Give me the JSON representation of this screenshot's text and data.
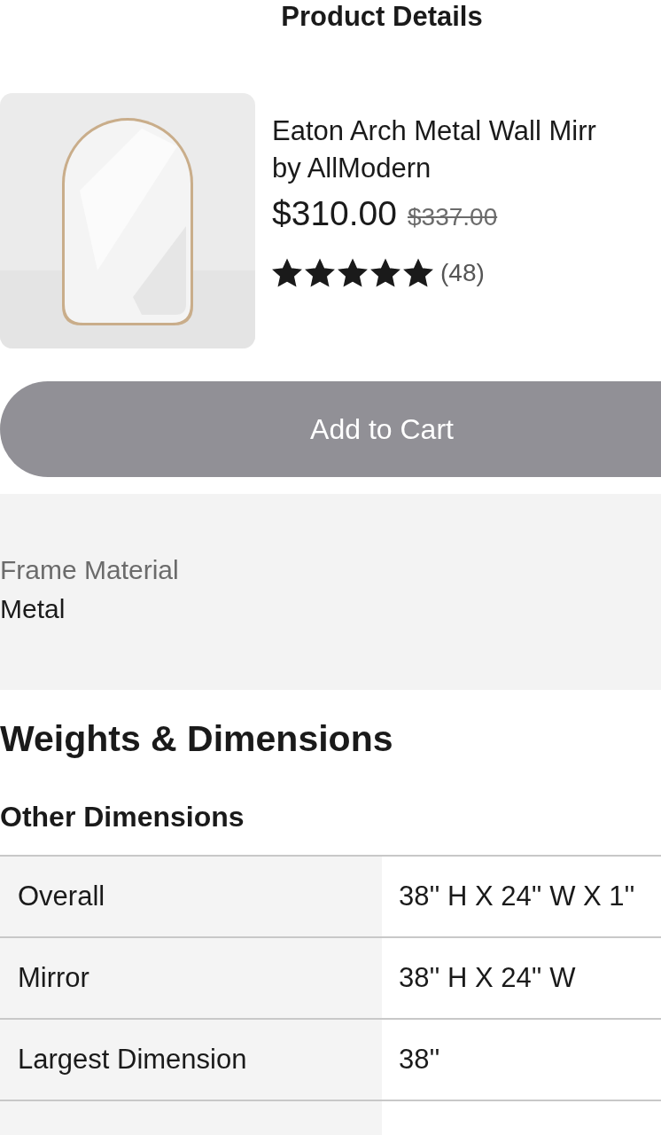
{
  "header": {
    "title": "Product Details"
  },
  "product": {
    "name": "Eaton Arch Metal Wall Mirr",
    "brand": "by AllModern",
    "price": "$310.00",
    "original_price": "$337.00",
    "stars": 5,
    "review_count": "(48)"
  },
  "add_to_cart": {
    "label": "Add to Cart",
    "disabled": true
  },
  "specs": [
    {
      "label": "Frame Material",
      "value": "Metal"
    }
  ],
  "section_title": "Weights & Dimensions",
  "subsection_title": "Other Dimensions",
  "table": {
    "rows": [
      {
        "label": "Overall",
        "value": "38'' H X 24'' W X 1''"
      },
      {
        "label": "Mirror",
        "value": "38'' H X 24'' W"
      },
      {
        "label": "Largest Dimension",
        "value": "38''"
      }
    ]
  }
}
